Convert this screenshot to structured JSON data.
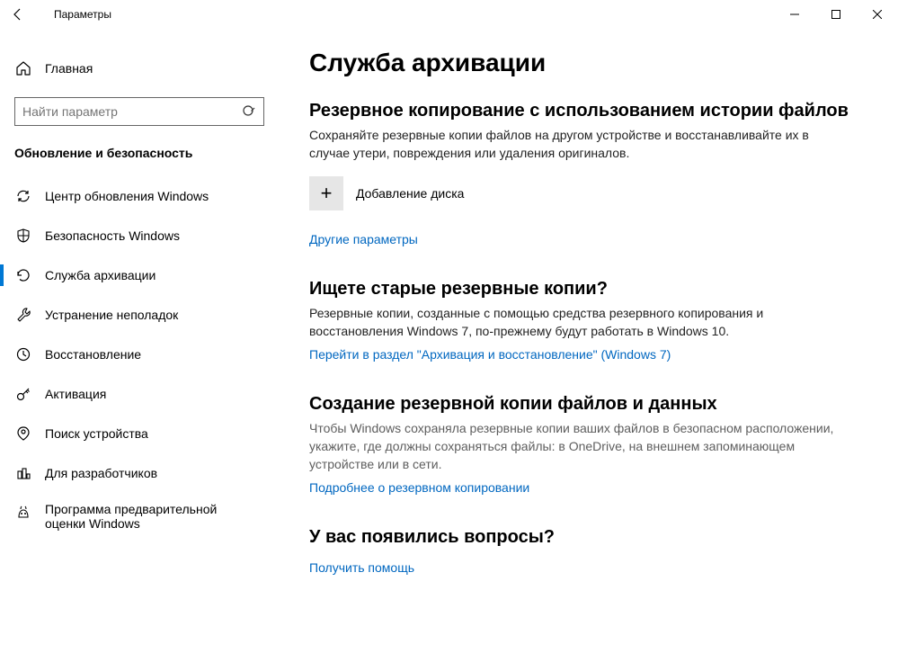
{
  "titlebar": {
    "title": "Параметры"
  },
  "sidebar": {
    "home": "Главная",
    "search_placeholder": "Найти параметр",
    "category": "Обновление и безопасность",
    "items": [
      {
        "label": "Центр обновления Windows"
      },
      {
        "label": "Безопасность Windows"
      },
      {
        "label": "Служба архивации"
      },
      {
        "label": "Устранение неполадок"
      },
      {
        "label": "Восстановление"
      },
      {
        "label": "Активация"
      },
      {
        "label": "Поиск устройства"
      },
      {
        "label": "Для разработчиков"
      },
      {
        "label": "Программа предварительной оценки Windows"
      }
    ]
  },
  "main": {
    "page_title": "Служба архивации",
    "section1": {
      "heading": "Резервное копирование с использованием истории файлов",
      "body": "Сохраняйте резервные копии файлов на другом устройстве и восстанавливайте их в случае утери, повреждения или удаления оригиналов.",
      "add_disk": "Добавление диска",
      "more_options": "Другие параметры"
    },
    "section2": {
      "heading": "Ищете старые резервные копии?",
      "body": "Резервные копии, созданные с помощью средства резервного копирования и восстановления Windows 7, по-прежнему будут работать в Windows 10.",
      "link": "Перейти в раздел \"Архивация и восстановление\" (Windows 7)"
    },
    "section3": {
      "heading": "Создание резервной копии файлов и данных",
      "body": "Чтобы Windows сохраняла резервные копии ваших файлов в безопасном расположении, укажите, где должны сохраняться файлы: в OneDrive, на внешнем запоминающем устройстве или в сети.",
      "link": "Подробнее о резервном копировании"
    },
    "section4": {
      "heading": "У вас появились вопросы?",
      "link": "Получить помощь"
    }
  }
}
